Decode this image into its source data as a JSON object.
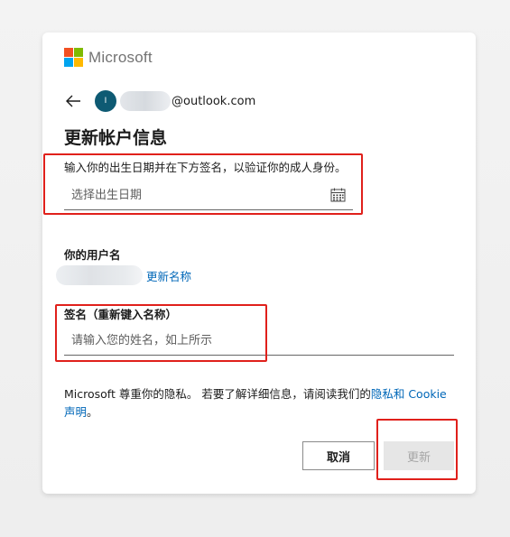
{
  "brand": {
    "name": "Microsoft",
    "logo_colors": [
      "#f25022",
      "#7fba00",
      "#00a4ef",
      "#ffb900"
    ]
  },
  "identity": {
    "avatar_initial": "I",
    "email_suffix": "@outlook.com"
  },
  "page_title": "更新帐户信息",
  "birthdate": {
    "instruction": "输入你的出生日期并在下方签名，以验证你的成人身份。",
    "placeholder": "选择出生日期"
  },
  "username": {
    "label": "你的用户名",
    "rename_link": "更新名称"
  },
  "signature": {
    "label": "签名（重新键入名称）",
    "placeholder": "请输入您的姓名，如上所示"
  },
  "privacy": {
    "text_before": "Microsoft 尊重你的隐私。 若要了解详细信息，请阅读我们的",
    "link": "隐私和 Cookie 声明",
    "text_after": "。"
  },
  "buttons": {
    "cancel": "取消",
    "update": "更新"
  },
  "colors": {
    "accent_link": "#0067b8",
    "avatar_bg": "#0e5a73",
    "annotation": "#e0201b"
  }
}
